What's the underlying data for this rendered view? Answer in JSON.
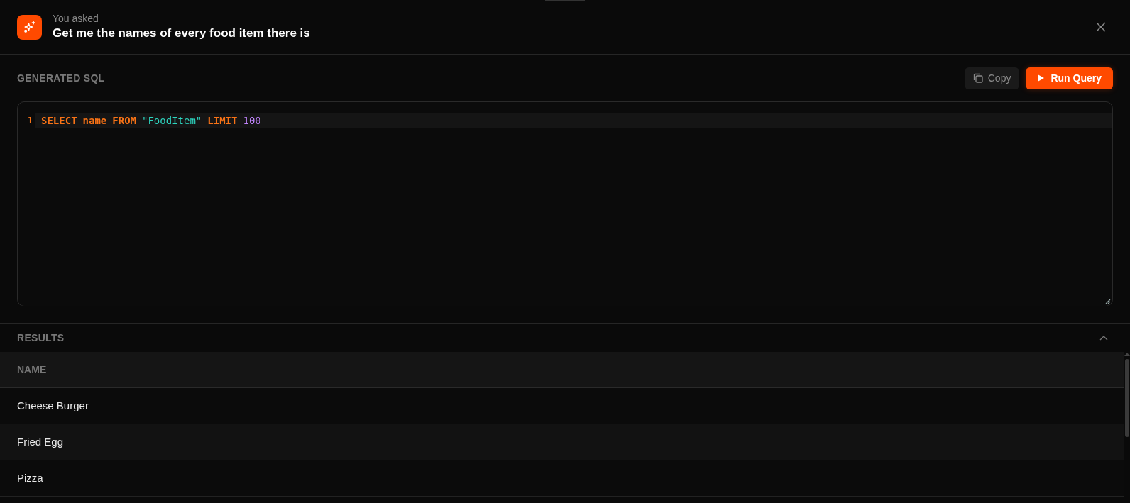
{
  "prompt": {
    "label": "You asked",
    "question": "Get me the names of every food item there is"
  },
  "sql": {
    "title": "GENERATED SQL",
    "buttons": [
      {
        "label": "Copy",
        "kind": "secondary"
      },
      {
        "label": "Run Query",
        "kind": "primary"
      }
    ],
    "lines": [
      {
        "number": "1",
        "tokens": [
          {
            "text": "SELECT",
            "kind": "keyword"
          },
          {
            "text": "name",
            "kind": "keyword"
          },
          {
            "text": "FROM",
            "kind": "keyword"
          },
          {
            "text": "\"FoodItem\"",
            "kind": "string"
          },
          {
            "text": "LIMIT",
            "kind": "keyword"
          },
          {
            "text": "100",
            "kind": "number"
          }
        ]
      }
    ]
  },
  "results": {
    "title": "RESULTS",
    "expanded": true,
    "columns": [
      "NAME"
    ],
    "rows": [
      [
        "Cheese Burger"
      ],
      [
        "Fried Egg"
      ],
      [
        "Pizza"
      ]
    ]
  }
}
